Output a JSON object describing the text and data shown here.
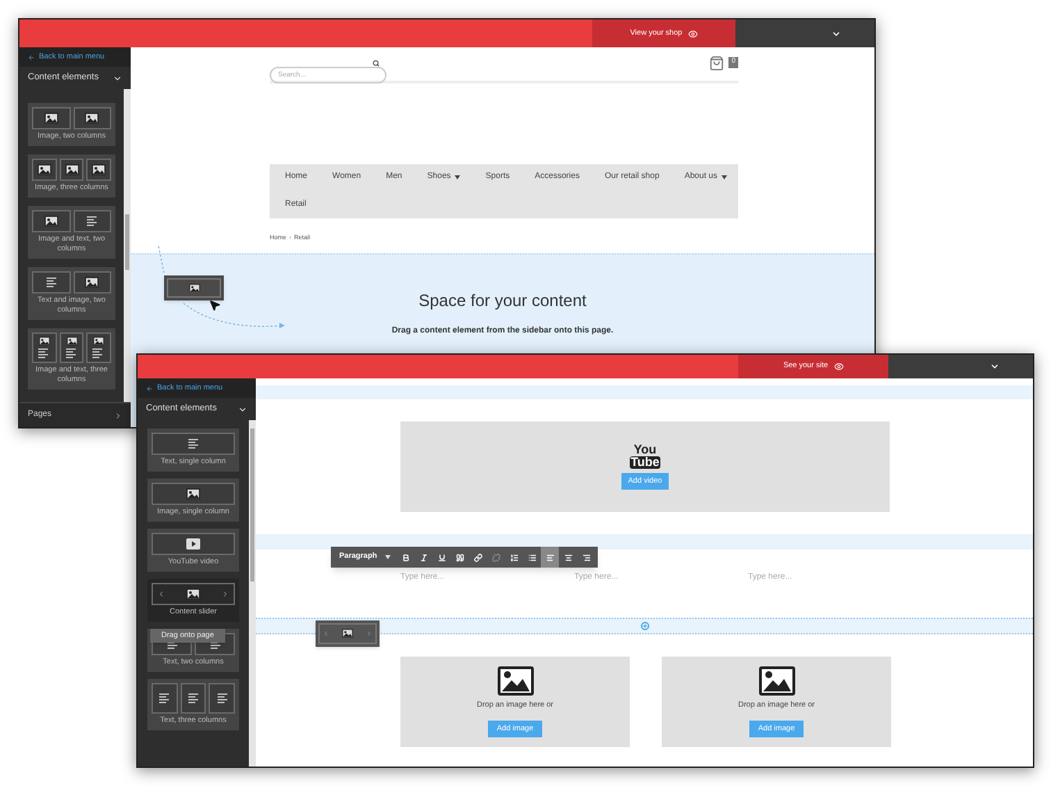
{
  "back_window": {
    "top_bar": {
      "site_link": "View your shop"
    },
    "sidebar": {
      "back_link": "Back to main menu",
      "section": "Content elements",
      "pages": "Pages",
      "elements": [
        {
          "label": "Image, two columns",
          "kind": "image-2"
        },
        {
          "label": "Image, three columns",
          "kind": "image-3"
        },
        {
          "label": "Image and text, two columns",
          "kind": "image-text-2"
        },
        {
          "label": "Text and image, two columns",
          "kind": "text-image-2"
        },
        {
          "label": "Image and text, three columns",
          "kind": "image-text-3"
        }
      ]
    },
    "page": {
      "search": {
        "placeholder": "Search..."
      },
      "cart_count": "0",
      "nav_rows": [
        [
          {
            "label": "Home",
            "has_submenu": false
          },
          {
            "label": "Women",
            "has_submenu": false
          },
          {
            "label": "Men",
            "has_submenu": false
          },
          {
            "label": "Shoes",
            "has_submenu": true
          },
          {
            "label": "Sports",
            "has_submenu": false
          },
          {
            "label": "Accessories",
            "has_submenu": false
          },
          {
            "label": "Our retail shop",
            "has_submenu": false
          },
          {
            "label": "About us",
            "has_submenu": true
          }
        ],
        [
          {
            "label": "Retail",
            "has_submenu": false
          }
        ]
      ],
      "breadcrumb": {
        "items": [
          "Home",
          "Retail"
        ],
        "separator": "›"
      },
      "drop_area": {
        "title": "Space for your content",
        "hint": "Drag a content element from the sidebar onto this page."
      }
    }
  },
  "front_window": {
    "top_bar": {
      "site_link": "See your site"
    },
    "sidebar": {
      "back_link": "Back to main menu",
      "section": "Content elements",
      "tooltip": "Drag onto page",
      "elements": [
        {
          "label": "Text, single column",
          "kind": "text-1",
          "selected": false
        },
        {
          "label": "Image, single column",
          "kind": "image-1",
          "selected": false
        },
        {
          "label": "YouTube video",
          "kind": "video",
          "selected": false
        },
        {
          "label": "Content slider",
          "kind": "slider",
          "selected": true
        },
        {
          "label": "Text, two columns",
          "kind": "text-2",
          "selected": false
        },
        {
          "label": "Text, three columns",
          "kind": "text-3",
          "selected": false
        }
      ]
    },
    "video_block": {
      "logo_top": "You",
      "logo_bottom": "Tube",
      "button": "Add video"
    },
    "toolbar": {
      "style": "Paragraph",
      "tools": [
        {
          "kind": "bold",
          "active": false,
          "disabled": false
        },
        {
          "kind": "italic",
          "active": false,
          "disabled": false
        },
        {
          "kind": "underline",
          "active": false,
          "disabled": false
        },
        {
          "kind": "quote",
          "active": false,
          "disabled": false
        },
        {
          "kind": "link",
          "active": false,
          "disabled": false
        },
        {
          "kind": "unlink",
          "active": false,
          "disabled": true
        },
        {
          "kind": "ordered-list",
          "active": false,
          "disabled": false
        },
        {
          "kind": "bullet-list",
          "active": false,
          "disabled": false
        },
        {
          "kind": "align-left",
          "active": true,
          "disabled": false
        },
        {
          "kind": "align-center",
          "active": false,
          "disabled": false
        },
        {
          "kind": "align-right",
          "active": false,
          "disabled": false
        }
      ]
    },
    "text_columns": [
      {
        "placeholder": "Type here..."
      },
      {
        "placeholder": "Type here..."
      },
      {
        "placeholder": "Type here..."
      }
    ],
    "image_blocks": [
      {
        "hint": "Drop an image here or",
        "button": "Add image"
      },
      {
        "hint": "Drop an image here or",
        "button": "Add image"
      }
    ]
  }
}
